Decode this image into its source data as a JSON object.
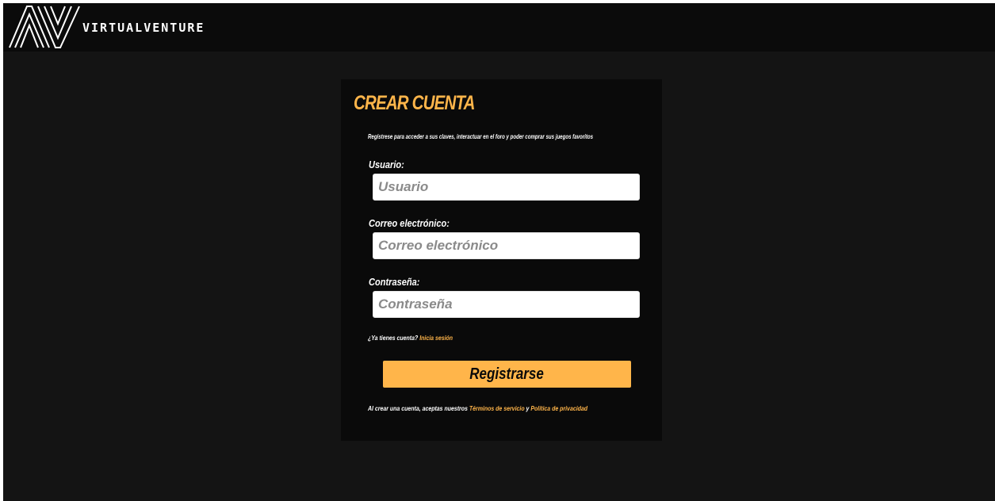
{
  "header": {
    "brand": "VIRTUALVENTURE",
    "logo_icon": "av-monogram-logo"
  },
  "form": {
    "title": "CREAR CUENTA",
    "subtitle": "Regístrese para acceder a sus claves, interactuar en el foro y poder comprar sus juegos favoritos",
    "fields": [
      {
        "label": "Usuario:",
        "placeholder": "Usuario",
        "value": ""
      },
      {
        "label": "Correo electrónico:",
        "placeholder": "Correo electrónico",
        "value": ""
      },
      {
        "label": "Contraseña:",
        "placeholder": "Contraseña",
        "value": ""
      }
    ],
    "login_prompt": "¿Ya tienes cuenta?",
    "login_link": "Inicia sesión",
    "submit_label": "Registrarse",
    "terms_prefix": "Al crear una cuenta, aceptas nuestros",
    "terms_link": "Términos de servicio",
    "terms_conjunction": "y",
    "privacy_link": "Política de privacidad"
  },
  "colors": {
    "accent": "#ffb54a",
    "background": "#141414",
    "header_background": "#0b0b0b",
    "card_background": "#0a0a0a"
  }
}
